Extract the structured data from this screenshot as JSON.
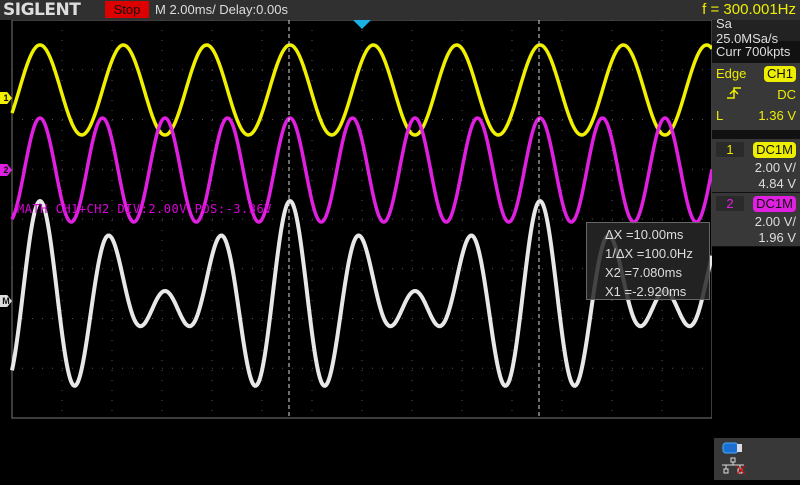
{
  "header": {
    "brand": "SIGLENT",
    "run_state": "Stop",
    "timebase": "M 2.00ms/ Delay:0.00s",
    "frequency": "f = 300.001Hz"
  },
  "acquisition": {
    "sample_rate": "Sa 25.0MSa/s",
    "memory": "Curr 700kpts"
  },
  "trigger": {
    "type": "Edge",
    "source": "CH1",
    "slope_icon": "rising-edge-icon",
    "coupling": "DC",
    "level_label": "L",
    "level": "1.36 V"
  },
  "channels": [
    {
      "num": "1",
      "coupling": "DC1M",
      "scale": "2.00 V/",
      "offset": "4.84 V",
      "color": "#f0f000",
      "freq_hz": 300,
      "amplitude_v": 1.8
    },
    {
      "num": "2",
      "coupling": "DC1M",
      "scale": "2.00 V/",
      "offset": "1.96 V",
      "color": "#e020e0",
      "freq_hz": 400,
      "amplitude_v": 2.08
    }
  ],
  "math": {
    "label": "MATH  CH1+CH2  DIV:2.00V  POS:-3.36V",
    "marker": "M",
    "color": "#e8e8e8"
  },
  "cursors": {
    "dx": "ΔX =10.00ms",
    "inv_dx": "1/ΔX =100.0Hz",
    "x2": "X2 =7.080ms",
    "x1": "X1 =-2.920ms"
  },
  "markers": {
    "ch1": "1",
    "ch2": "2"
  },
  "status_icons": [
    "usb-icon",
    "network-disconnected-icon"
  ]
}
